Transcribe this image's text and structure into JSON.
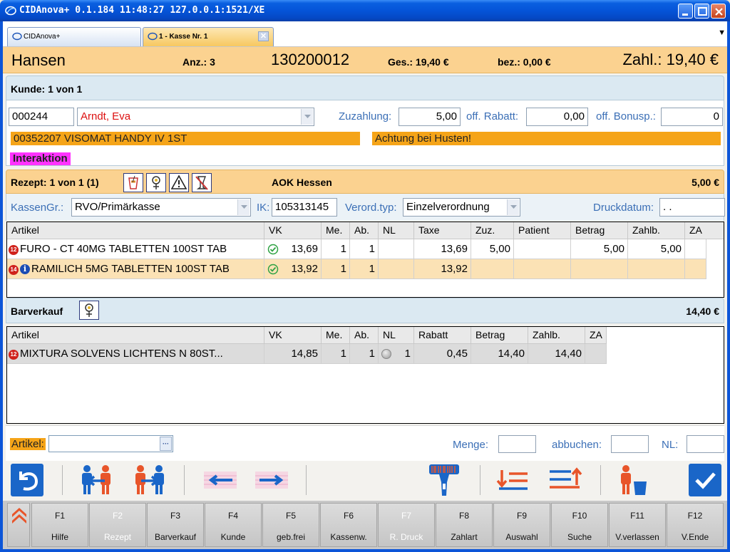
{
  "window": {
    "title": "CIDAnova+  0.1.184  11:48:27  127.0.0.1:1521/XE"
  },
  "tabs": [
    {
      "label": "CIDAnova+"
    },
    {
      "label": "1 - Kasse Nr. 1"
    }
  ],
  "header": {
    "customer_name": "Hansen",
    "anz": "Anz.: 3",
    "number": "130200012",
    "ges": "Ges.: 19,40 €",
    "bez": "bez.: 0,00 €",
    "zahl": "Zahl.: 19,40 €"
  },
  "kunde": {
    "title": "Kunde: 1 von 1",
    "id": "000244",
    "name": "Arndt, Eva",
    "zuzahlung_label": "Zuzahlung:",
    "zuzahlung": "5,00",
    "rabatt_label": "off. Rabatt:",
    "rabatt": "0,00",
    "bonus_label": "off. Bonusp.:",
    "bonus": "0",
    "device": "00352207 VISOMAT HANDY IV 1ST",
    "warning": "Achtung bei Husten!",
    "interaktion": "Interaktion"
  },
  "rezept": {
    "title": "Rezept:  1 von 1 (1)",
    "kasse": "AOK Hessen",
    "amount": "5,00 €",
    "kassengr_label": "KassenGr.:",
    "kassengr": "RVO/Primärkasse",
    "ik_label": "IK:",
    "ik": "105313145",
    "verord_label": "Verord.typ:",
    "verord": "Einzelverordnung",
    "druck_label": "Druckdatum:",
    "druck": " .  ."
  },
  "rezept_table": {
    "headers": [
      "Artikel",
      "VK",
      "Me.",
      "Ab.",
      "NL",
      "Taxe",
      "Zuz.",
      "Patient",
      "Betrag",
      "Zahlb.",
      "ZA"
    ],
    "rows": [
      {
        "badge": "12",
        "info": false,
        "artikel": "FURO - CT 40MG TABLETTEN 100ST TAB",
        "vk": "13,69",
        "me": "1",
        "ab": "1",
        "nl": "",
        "taxe": "13,69",
        "zuz": "5,00",
        "patient": "",
        "betrag": "5,00",
        "zahlb": "5,00",
        "za": ""
      },
      {
        "badge": "14",
        "info": true,
        "artikel": "RAMILICH 5MG TABLETTEN 100ST TAB",
        "vk": "13,92",
        "me": "1",
        "ab": "1",
        "nl": "",
        "taxe": "13,92",
        "zuz": "",
        "patient": "",
        "betrag": "",
        "zahlb": "",
        "za": ""
      }
    ]
  },
  "barverkauf": {
    "title": "Barverkauf",
    "amount": "14,40 €"
  },
  "bar_table": {
    "headers": [
      "Artikel",
      "VK",
      "Me.",
      "Ab.",
      "NL",
      "Rabatt",
      "Betrag",
      "Zahlb.",
      "ZA"
    ],
    "rows": [
      {
        "badge": "12",
        "artikel": "MIXTURA  SOLVENS  LICHTENS  N  80ST...",
        "vk": "14,85",
        "me": "1",
        "ab": "1",
        "nl": "1",
        "rabatt": "0,45",
        "betrag": "14,40",
        "zahlb": "14,40",
        "za": ""
      }
    ]
  },
  "entry": {
    "artikel_label": "Artikel:",
    "menge_label": "Menge:",
    "abbuchen_label": "abbuchen:",
    "nl_label": "NL:",
    "browse": "···"
  },
  "colors": {
    "accent_orange": "#f5a418",
    "header_bg": "#fbd290",
    "blue_label": "#3b6fb6",
    "toolbar_blue": "#1a66c8"
  },
  "fkeys": [
    {
      "key": "F1",
      "label": "Hilfe",
      "disabled": false
    },
    {
      "key": "F2",
      "label": "Rezept",
      "disabled": true
    },
    {
      "key": "F3",
      "label": "Barverkauf",
      "disabled": false
    },
    {
      "key": "F4",
      "label": "Kunde",
      "disabled": false
    },
    {
      "key": "F5",
      "label": "geb.frei",
      "disabled": false
    },
    {
      "key": "F6",
      "label": "Kassenw.",
      "disabled": false
    },
    {
      "key": "F7",
      "label": "R. Druck",
      "disabled": true
    },
    {
      "key": "F8",
      "label": "Zahlart",
      "disabled": false
    },
    {
      "key": "F9",
      "label": "Auswahl",
      "disabled": false
    },
    {
      "key": "F10",
      "label": "Suche",
      "disabled": false
    },
    {
      "key": "F11",
      "label": "V.verlassen",
      "disabled": false
    },
    {
      "key": "F12",
      "label": "V.Ende",
      "disabled": false
    }
  ]
}
